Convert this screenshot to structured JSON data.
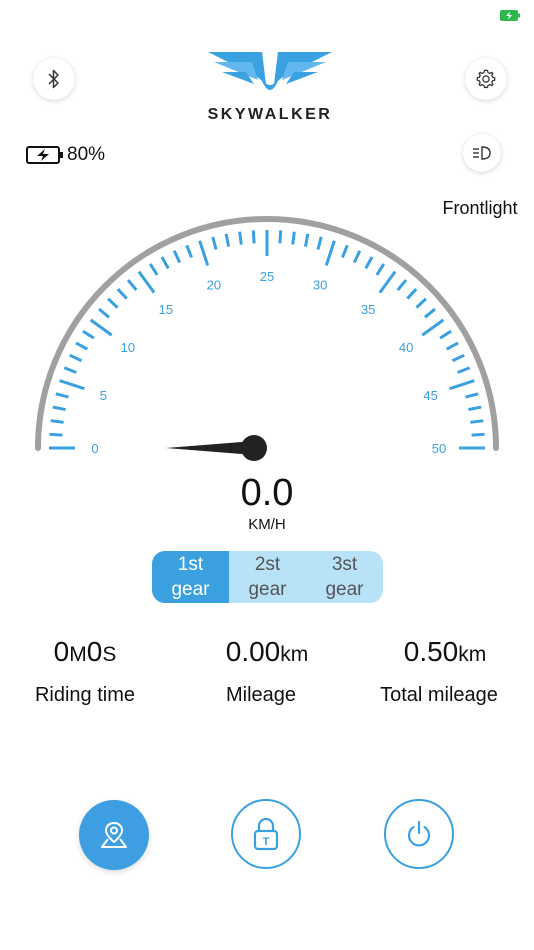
{
  "status_bar": {
    "battery_icon": "battery-charging-icon",
    "battery_color": "#2db84d"
  },
  "header": {
    "brand": "SKYWALKER",
    "logo_icon": "winged-logo-icon",
    "bluetooth_icon": "bluetooth-icon",
    "settings_icon": "gear-icon"
  },
  "battery": {
    "percent_text": "80%",
    "icon": "battery-charging-icon"
  },
  "frontlight": {
    "label": "Frontlight",
    "icon": "headlight-icon"
  },
  "speedometer": {
    "min": 0,
    "max": 50,
    "major_step": 5,
    "tick_labels": [
      "0",
      "5",
      "10",
      "15",
      "20",
      "25",
      "30",
      "35",
      "40",
      "45",
      "50"
    ],
    "current_speed": 0.0,
    "speed_text": "0.0",
    "unit": "KM/H",
    "accent_color": "#3aa0e0",
    "arc_color": "#a0a0a0"
  },
  "gears": [
    {
      "line1": "1st",
      "line2": "gear",
      "active": true
    },
    {
      "line1": "2st",
      "line2": "gear",
      "active": false
    },
    {
      "line1": "3st",
      "line2": "gear",
      "active": false
    }
  ],
  "stats": {
    "riding_time": {
      "h": "0",
      "m": "M",
      "s_val": "0",
      "s": "S",
      "label": "Riding time"
    },
    "mileage": {
      "value": "0.00",
      "unit": "km",
      "label": "Mileage"
    },
    "total_mileage": {
      "value": "0.50",
      "unit": "km",
      "label": "Total mileage"
    }
  },
  "bottom_bar": {
    "map_icon": "map-pin-icon",
    "lock_icon": "lock-icon",
    "lock_glyph": "T",
    "power_icon": "power-icon"
  }
}
